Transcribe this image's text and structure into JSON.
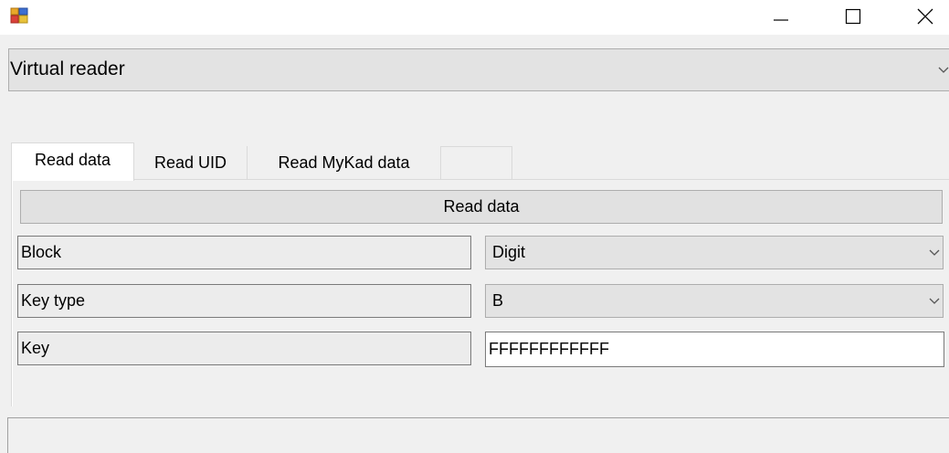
{
  "window": {
    "icon": "winforms-app-icon",
    "controls": {
      "minimize": "minimize-icon",
      "maximize": "maximize-icon",
      "close": "close-icon"
    }
  },
  "reader": {
    "selected": "Virtual reader"
  },
  "tabs": [
    {
      "label": "Read data",
      "active": true
    },
    {
      "label": "Read UID",
      "active": false
    },
    {
      "label": "Read MyKad data",
      "active": false
    }
  ],
  "read_data_page": {
    "read_button_label": "Read data",
    "rows": [
      {
        "label": "Block",
        "value": "Digit",
        "control": "dropdown"
      },
      {
        "label": "Key type",
        "value": "B",
        "control": "dropdown"
      },
      {
        "label": "Key",
        "value": "FFFFFFFFFFFF",
        "control": "textbox"
      }
    ]
  },
  "status": {
    "text": ""
  }
}
